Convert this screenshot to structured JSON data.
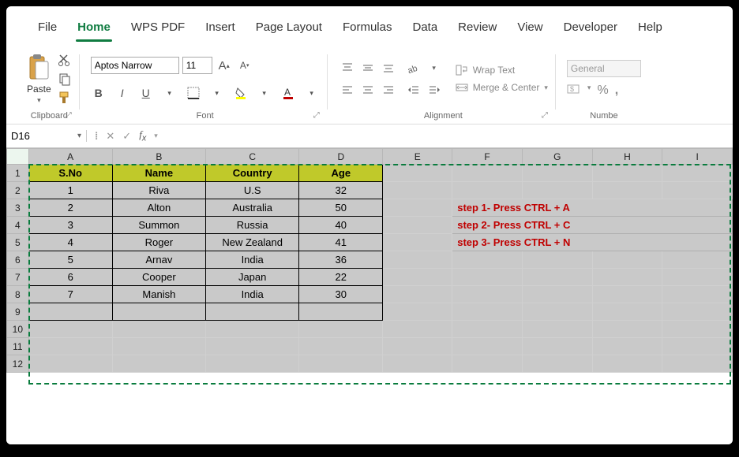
{
  "menu": {
    "tabs": [
      "File",
      "Home",
      "WPS PDF",
      "Insert",
      "Page Layout",
      "Formulas",
      "Data",
      "Review",
      "View",
      "Developer",
      "Help"
    ],
    "active": "Home"
  },
  "ribbon": {
    "clipboard": {
      "label": "Clipboard",
      "paste": "Paste"
    },
    "font": {
      "label": "Font",
      "name": "Aptos Narrow",
      "size": "11",
      "bold": "B",
      "italic": "I",
      "underline": "U"
    },
    "alignment": {
      "label": "Alignment",
      "wrap": "Wrap Text",
      "merge": "Merge & Center"
    },
    "number": {
      "label": "Numbe",
      "format": "General",
      "percent": "%"
    }
  },
  "namebox": "D16",
  "formula": "",
  "columns": [
    "A",
    "B",
    "C",
    "D",
    "E",
    "F",
    "G",
    "H",
    "I"
  ],
  "rows": [
    1,
    2,
    3,
    4,
    5,
    6,
    7,
    8,
    9,
    10,
    11,
    12
  ],
  "headers": [
    "S.No",
    "Name",
    "Country",
    "Age"
  ],
  "data": [
    [
      "1",
      "Riva",
      "U.S",
      "32"
    ],
    [
      "2",
      "Alton",
      "Australia",
      "50"
    ],
    [
      "3",
      "Summon",
      "Russia",
      "40"
    ],
    [
      "4",
      "Roger",
      "New Zealand",
      "41"
    ],
    [
      "5",
      "Arnav",
      "India",
      "36"
    ],
    [
      "6",
      "Cooper",
      "Japan",
      "22"
    ],
    [
      "7",
      "Manish",
      "India",
      "30"
    ]
  ],
  "steps": [
    "step 1- Press CTRL + A",
    "step 2- Press CTRL + C",
    "step 3- Press CTRL + N"
  ],
  "chart_data": {
    "type": "table",
    "columns": [
      "S.No",
      "Name",
      "Country",
      "Age"
    ],
    "rows": [
      [
        1,
        "Riva",
        "U.S",
        32
      ],
      [
        2,
        "Alton",
        "Australia",
        50
      ],
      [
        3,
        "Summon",
        "Russia",
        40
      ],
      [
        4,
        "Roger",
        "New Zealand",
        41
      ],
      [
        5,
        "Arnav",
        "India",
        36
      ],
      [
        6,
        "Cooper",
        "Japan",
        22
      ],
      [
        7,
        "Manish",
        "India",
        30
      ]
    ]
  }
}
